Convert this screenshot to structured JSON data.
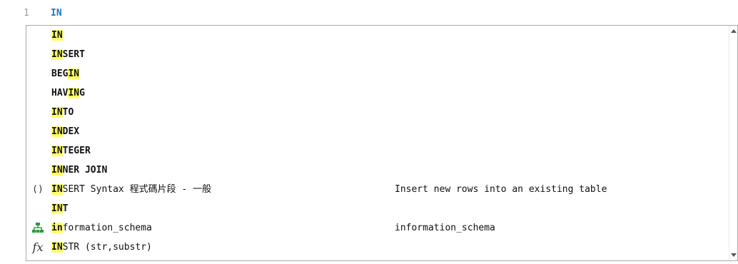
{
  "editor": {
    "line_number": "1",
    "code": "IN"
  },
  "popup": {
    "items": [
      {
        "icon": "",
        "match": "IN",
        "rest": "",
        "desc": ""
      },
      {
        "icon": "",
        "match": "IN",
        "rest": "SERT",
        "desc": ""
      },
      {
        "icon": "",
        "pre": "BEG",
        "match": "IN",
        "rest": "",
        "desc": ""
      },
      {
        "icon": "",
        "pre": "HAV",
        "match": "IN",
        "rest": "G",
        "desc": ""
      },
      {
        "icon": "",
        "match": "IN",
        "rest": "TO",
        "desc": ""
      },
      {
        "icon": "",
        "match": "IN",
        "rest": "DEX",
        "desc": ""
      },
      {
        "icon": "",
        "match": "IN",
        "rest": "TEGER",
        "desc": ""
      },
      {
        "icon": "",
        "match": "IN",
        "rest": "NER JOIN",
        "desc": ""
      },
      {
        "icon": "parentheses-icon",
        "icon_text": "()",
        "match": "IN",
        "rest": "SERT Syntax 程式碼片段 - 一般",
        "desc": "Insert new rows into an existing table"
      },
      {
        "icon": "",
        "match": "IN",
        "rest": "T",
        "desc": ""
      },
      {
        "icon": "schema-icon",
        "match": "in",
        "rest": "formation_schema",
        "desc": "information_schema"
      },
      {
        "icon": "function-icon",
        "icon_text": "fx",
        "match": "IN",
        "rest": "STR (str,substr)",
        "desc": ""
      }
    ]
  },
  "colors": {
    "highlight": "#ffff66",
    "editor_keyword": "#1c78c8",
    "line_number": "#9a9a9a",
    "schema_icon": "#2e9a3a",
    "function_icon": "#2a5caa"
  }
}
